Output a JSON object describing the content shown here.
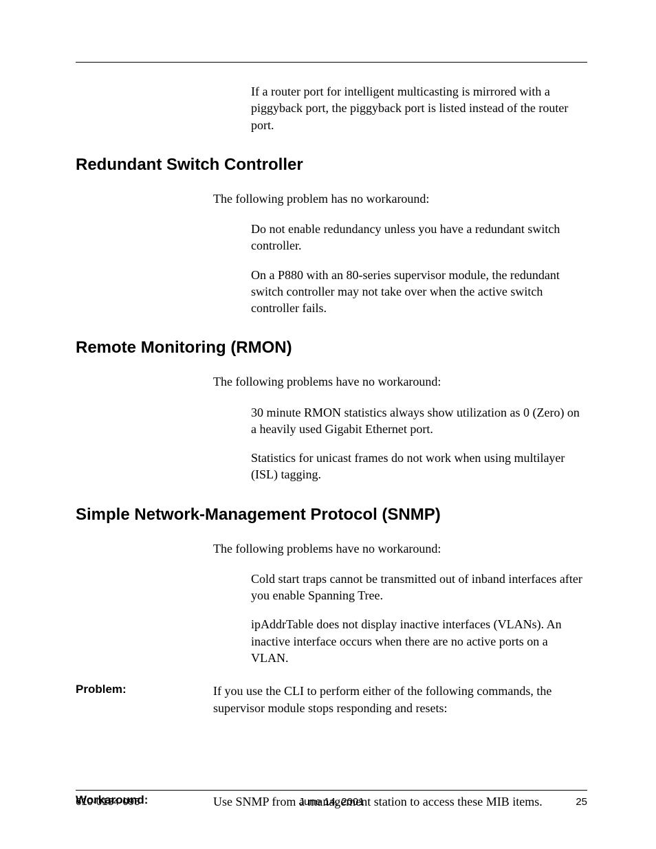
{
  "top_paragraph": "If a router port for intelligent multicasting is mirrored with a piggyback port, the piggyback port is listed instead of the router port.",
  "sections": {
    "redundant": {
      "heading": "Redundant Switch Controller",
      "intro": "The following problem has no workaround:",
      "items": [
        "Do not enable redundancy unless you have a redundant switch controller.",
        "On a P880 with an 80-series supervisor module, the redundant switch controller may not take over when the active switch controller fails."
      ]
    },
    "rmon": {
      "heading": "Remote Monitoring (RMON)",
      "intro": "The following problems have no workaround:",
      "items": [
        "30 minute RMON statistics always show utilization as 0 (Zero) on a heavily used Gigabit Ethernet port.",
        "Statistics for unicast frames do not work when using multilayer (ISL) tagging."
      ]
    },
    "snmp": {
      "heading": "Simple Network-Management Protocol (SNMP)",
      "intro": "The following problems have no workaround:",
      "items": [
        "Cold start traps cannot be transmitted out of inband interfaces after you enable Spanning Tree.",
        "ipAddrTable does not display inactive interfaces (VLANs). An inactive interface occurs when there are no active ports on a VLAN."
      ],
      "problem_label": "Problem:",
      "problem_text": "If you use the CLI to perform either of the following commands, the supervisor module stops responding and resets:",
      "workaround_label": "Workaround:",
      "workaround_text": "Use SNMP from a management station to access these MIB items."
    }
  },
  "footer": {
    "doc_id": "610-0184-095",
    "date": "June 14, 2001",
    "page": "25"
  }
}
